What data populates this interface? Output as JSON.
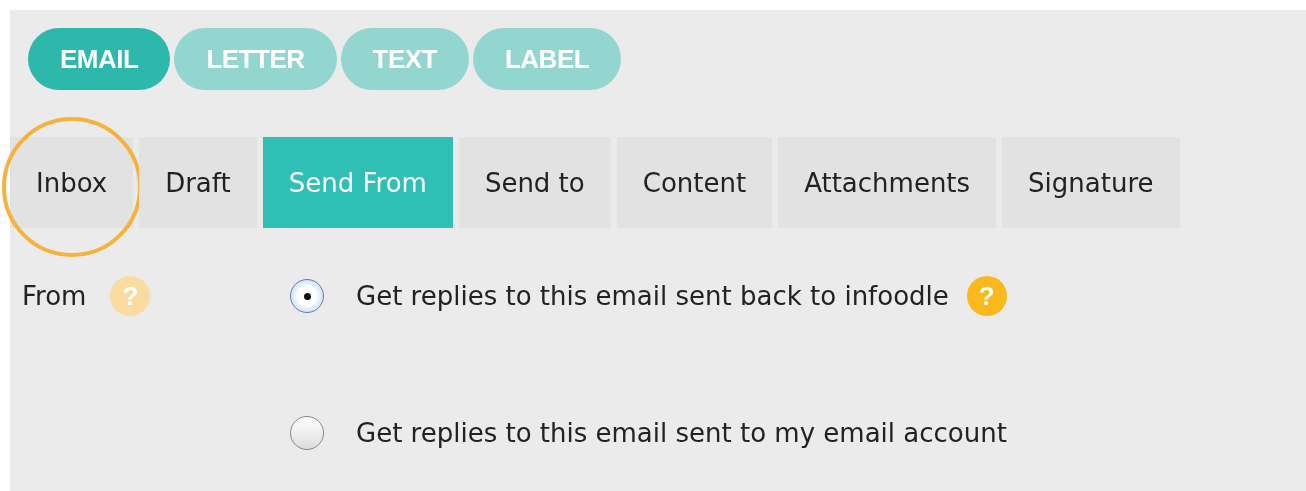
{
  "pills": [
    {
      "label": "EMAIL",
      "selected": true
    },
    {
      "label": "LETTER",
      "selected": false
    },
    {
      "label": "TEXT",
      "selected": false
    },
    {
      "label": "LABEL",
      "selected": false
    }
  ],
  "tabs": [
    {
      "label": "Inbox",
      "selected": false,
      "circled": true
    },
    {
      "label": "Draft",
      "selected": false,
      "circled": false
    },
    {
      "label": "Send From",
      "selected": true,
      "circled": false
    },
    {
      "label": "Send to",
      "selected": false,
      "circled": false
    },
    {
      "label": "Content",
      "selected": false,
      "circled": false
    },
    {
      "label": "Attachments",
      "selected": false,
      "circled": false
    },
    {
      "label": "Signature",
      "selected": false,
      "circled": false
    }
  ],
  "from": {
    "label": "From",
    "help": {
      "glyph": "?",
      "dimmed": true
    }
  },
  "options": [
    {
      "label": "Get replies to this email sent back to infoodle",
      "selected": true,
      "help": {
        "glyph": "?",
        "dimmed": false
      }
    },
    {
      "label": "Get replies to this email sent to my email account",
      "selected": false
    }
  ]
}
